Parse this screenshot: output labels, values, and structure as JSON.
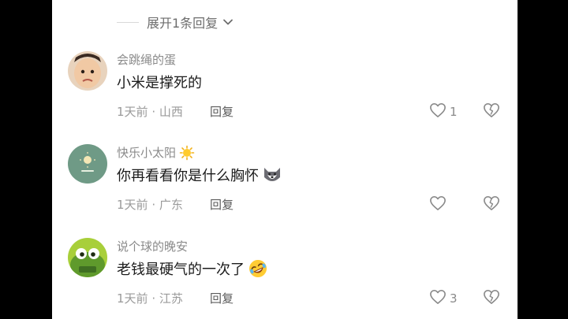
{
  "expand_replies": {
    "label": "展开1条回复"
  },
  "comments": [
    {
      "username": "会跳绳的蛋",
      "text": "小米是撑死的",
      "time": "1天前",
      "location": "山西",
      "reply_label": "回复",
      "like_count": "1"
    },
    {
      "username": "快乐小太阳",
      "username_emoji": "sun-emoji-icon",
      "text": "你再看看你是什么胸怀",
      "text_emoji": "husky-emoji-icon",
      "time": "1天前",
      "location": "广东",
      "reply_label": "回复",
      "like_count": ""
    },
    {
      "username": "说个球的晚安",
      "text": "老钱最硬气的一次了",
      "text_emoji": "rofl-emoji-icon",
      "time": "1天前",
      "location": "江苏",
      "reply_label": "回复",
      "like_count": "3"
    }
  ],
  "colors": {
    "panel_bg": "#ffffff",
    "letterbox": "#000000",
    "username": "#8a8a8a",
    "text": "#1c1c1c",
    "meta": "#9a9a9a"
  }
}
